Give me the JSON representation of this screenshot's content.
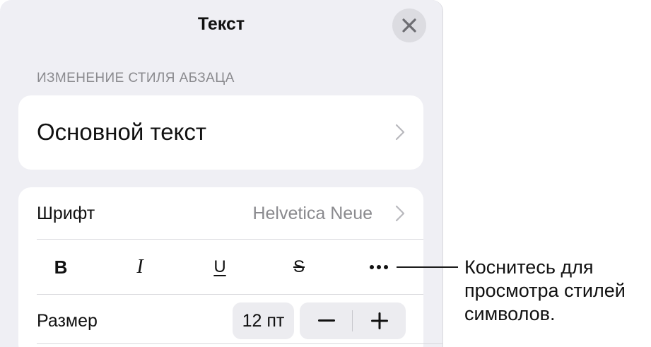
{
  "panel": {
    "title": "Текст",
    "close_icon": "xmark-icon"
  },
  "paragraph_style": {
    "section_header": "ИЗМЕНЕНИЕ СТИЛЯ АБЗАЦА",
    "value": "Основной текст"
  },
  "font": {
    "label": "Шрифт",
    "value": "Helvetica Neue"
  },
  "char_styles": {
    "bold": "B",
    "italic": "I",
    "underline": "U",
    "strikethrough": "S",
    "more_icon": "ellipsis-icon"
  },
  "size": {
    "label": "Размер",
    "value": "12 пт",
    "decrease_icon": "minus-icon",
    "increase_icon": "plus-icon"
  },
  "callout": {
    "text": "Коснитесь для просмотра стилей символов."
  }
}
